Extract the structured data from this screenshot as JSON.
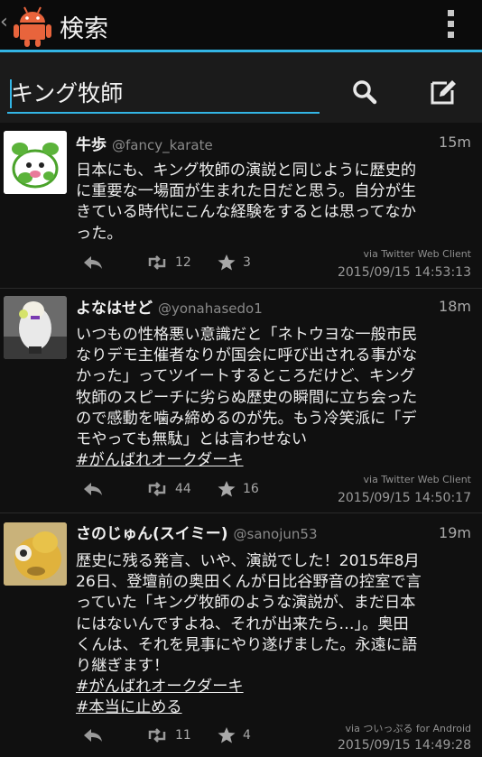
{
  "actionbar": {
    "title": "検索",
    "back": "‹"
  },
  "search": {
    "query": "キング牧師"
  },
  "tweets": [
    {
      "name": "牛歩",
      "handle": "@fancy_karate",
      "age": "15m",
      "lines": [
        "日本にも、キング牧師の演説と同じように歴史的",
        "に重要な一場面が生まれた日だと思う。自分が生",
        "きている時代にこんな経験をするとは思ってなか",
        "った。"
      ],
      "hashtags": [],
      "via": "via Twitter Web Client",
      "timestamp": "2015/09/15 14:53:13",
      "retweets": "12",
      "favorites": "3"
    },
    {
      "name": "よなはせど",
      "handle": "@yonahasedo1",
      "age": "18m",
      "lines": [
        "いつもの性格悪い意識だと「ネトウヨな一般市民",
        "なりデモ主催者なりが国会に呼び出される事がな",
        "かった」ってツイートするところだけど、キング",
        "牧師のスピーチに劣らぬ歴史の瞬間に立ち会った",
        "ので感動を噛み締めるのが先。もう冷笑派に「デ",
        "モやっても無駄」とは言わせない"
      ],
      "hashtags": [
        "#がんばれオークダーキ"
      ],
      "via": "via Twitter Web Client",
      "timestamp": "2015/09/15 14:50:17",
      "retweets": "44",
      "favorites": "16"
    },
    {
      "name": "さのじゅん(スイミー)",
      "handle": "@sanojun53",
      "age": "19m",
      "lines": [
        "歴史に残る発言、いや、演説でした！2015年8月",
        "26日、登壇前の奥田くんが日比谷野音の控室で言",
        "っていた「キング牧師のような演説が、まだ日本",
        "にはないんですよね、それが出来たら…」。奥田",
        "くんは、それを見事にやり遂げました。永遠に語",
        "り継ぎます！"
      ],
      "hashtags": [
        "#がんばれオークダーキ",
        "#本当に止める"
      ],
      "via": "via ついっぷる for Android",
      "timestamp": "2015/09/15 14:49:28",
      "retweets": "11",
      "favorites": "4"
    }
  ]
}
